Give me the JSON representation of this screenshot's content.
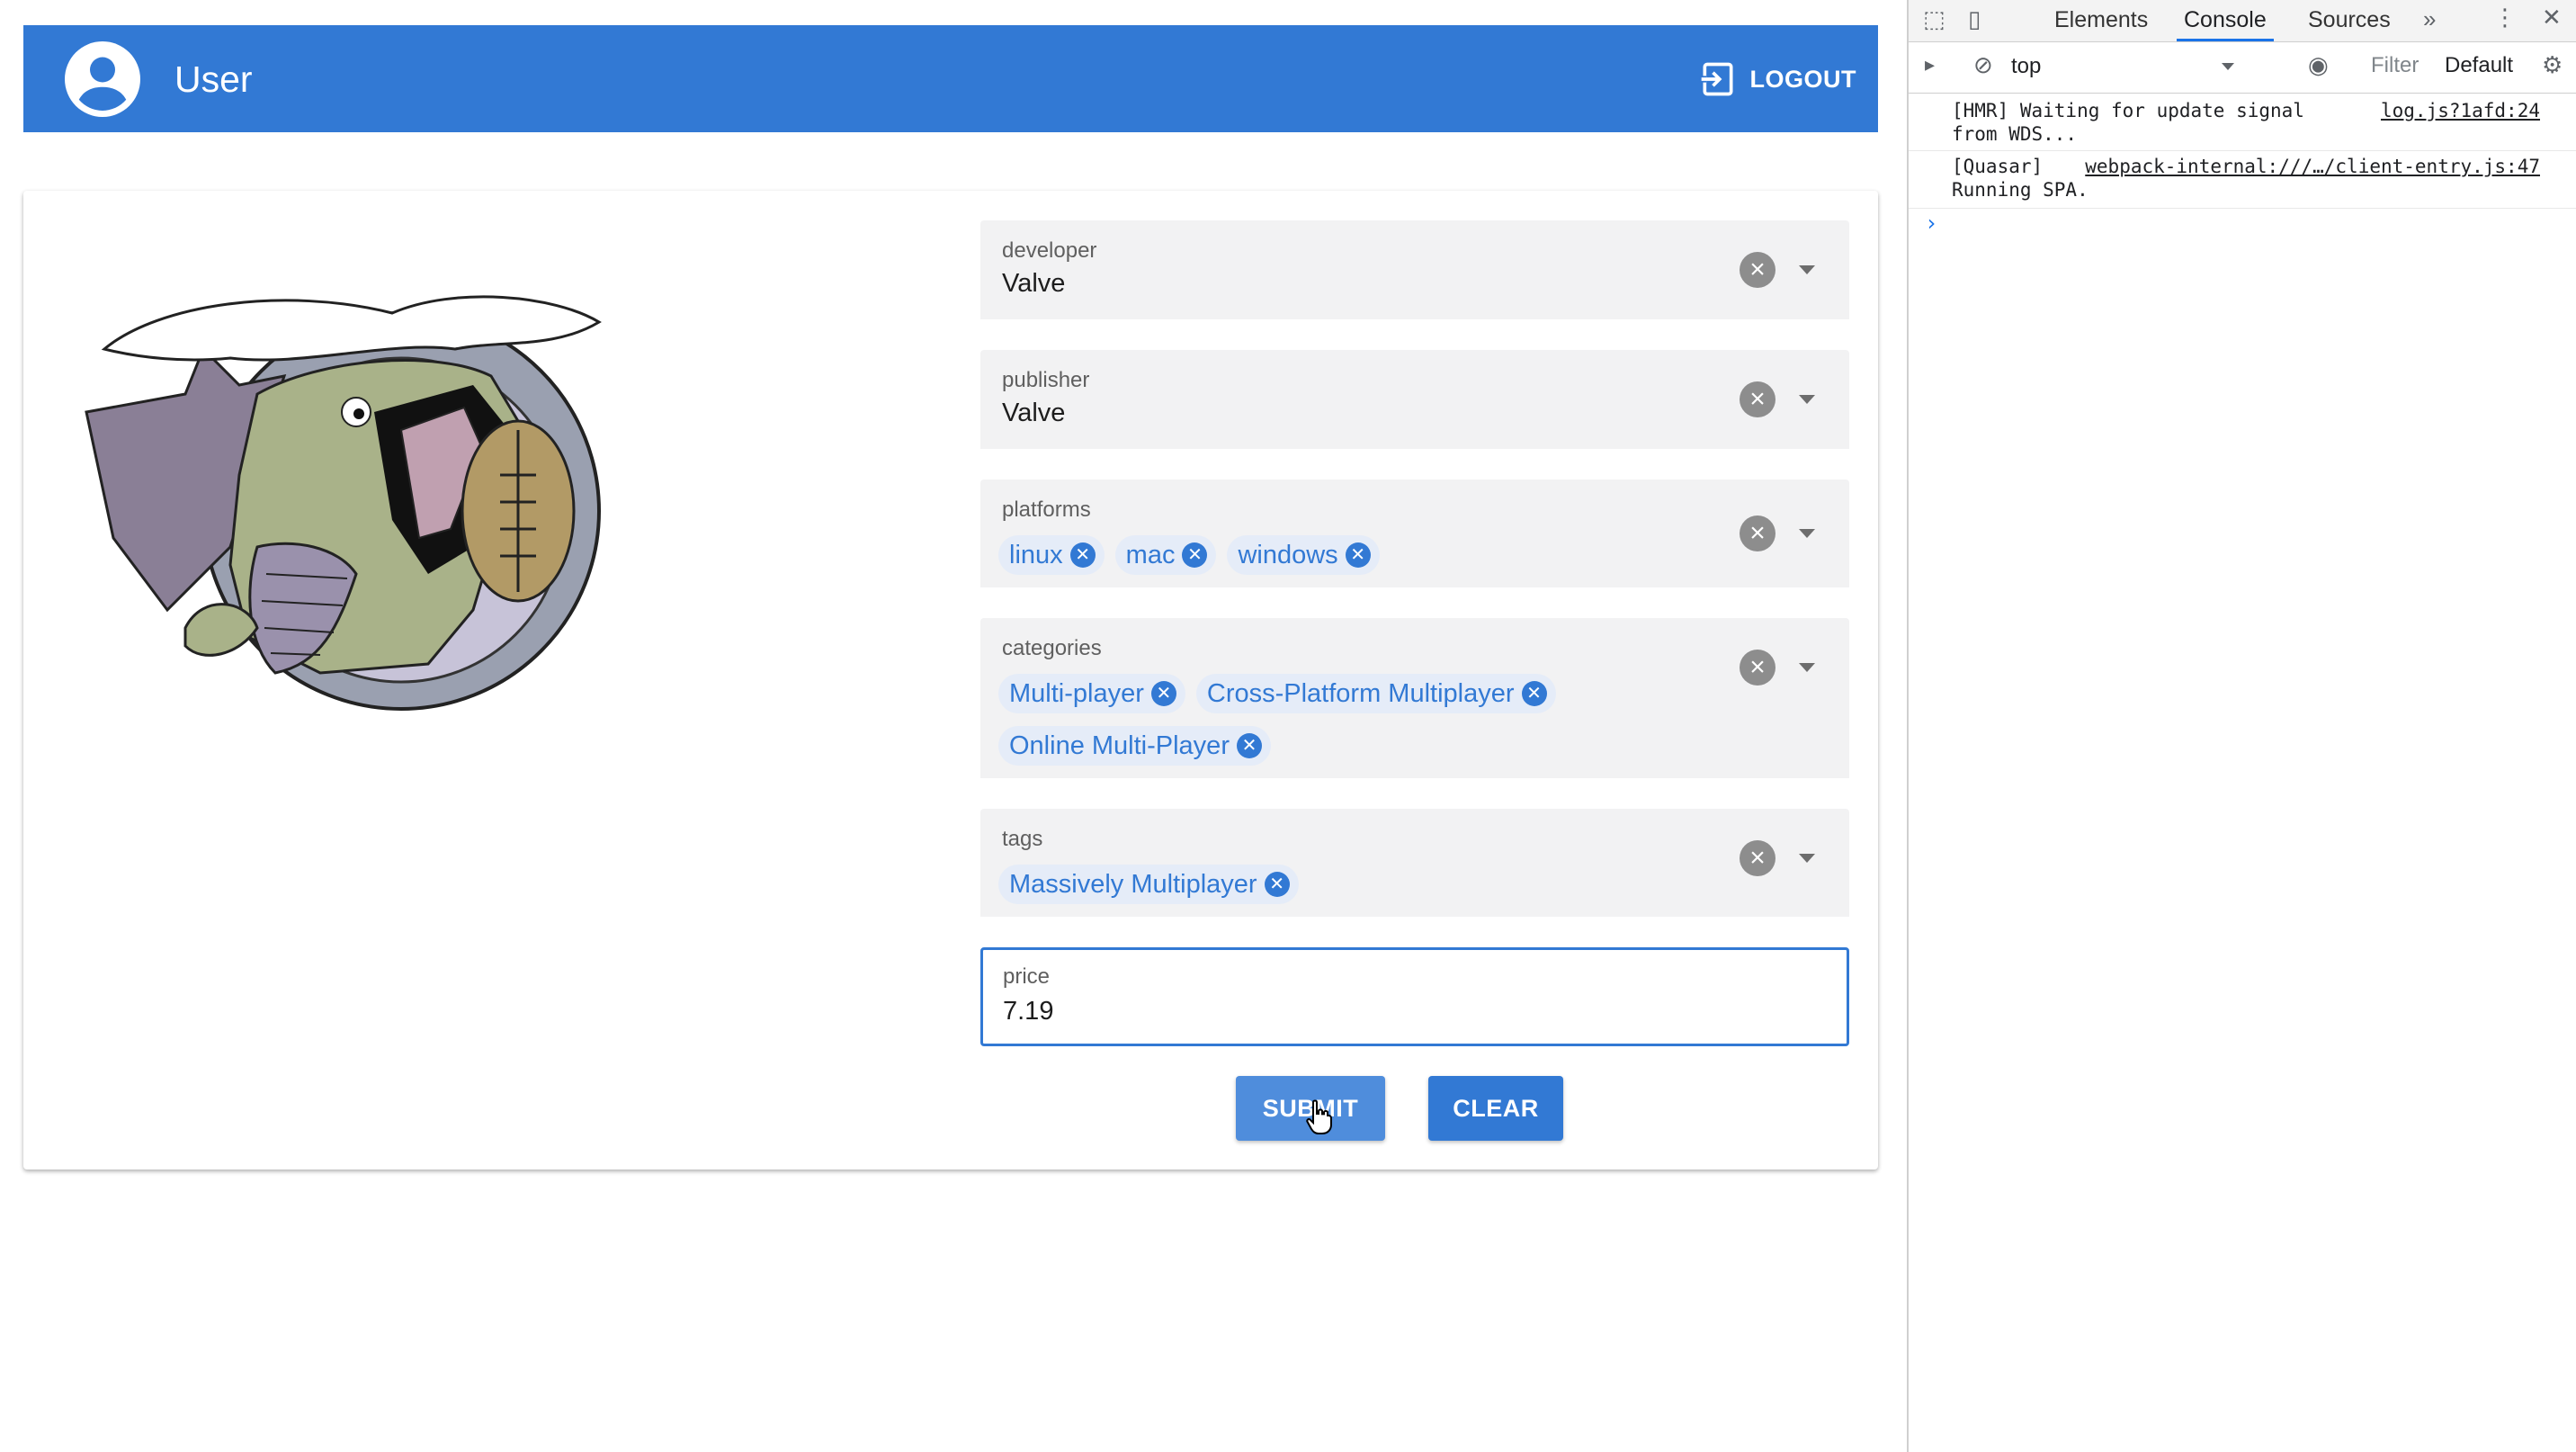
{
  "header": {
    "title": "User",
    "logout_label": "LOGOUT"
  },
  "form": {
    "developer": {
      "label": "developer",
      "value": "Valve"
    },
    "publisher": {
      "label": "publisher",
      "value": "Valve"
    },
    "platforms": {
      "label": "platforms",
      "chips": [
        "linux",
        "mac",
        "windows"
      ]
    },
    "categories": {
      "label": "categories",
      "chips": [
        "Multi-player",
        "Cross-Platform Multiplayer",
        "Online Multi-Player"
      ]
    },
    "tags": {
      "label": "tags",
      "chips": [
        "Massively Multiplayer"
      ]
    },
    "price": {
      "label": "price",
      "value": "7.19"
    },
    "submit_label": "SUBMIT",
    "clear_label": "CLEAR"
  },
  "devtools": {
    "tabs": [
      "Elements",
      "Console",
      "Sources"
    ],
    "active_tab": "Console",
    "context": "top",
    "filter_placeholder": "Filter",
    "levels": "Default",
    "logs": [
      {
        "message": "[HMR] Waiting for update signal\nfrom WDS...",
        "source": "log.js?1afd:24"
      },
      {
        "message": "[Quasar]\nRunning SPA.",
        "source": "webpack-internal:///…/client-entry.js:47"
      }
    ],
    "prompt": "›"
  },
  "colors": {
    "primary": "#3279d4",
    "chip_bg": "#e5ecf8",
    "field_bg": "#f2f2f3"
  }
}
